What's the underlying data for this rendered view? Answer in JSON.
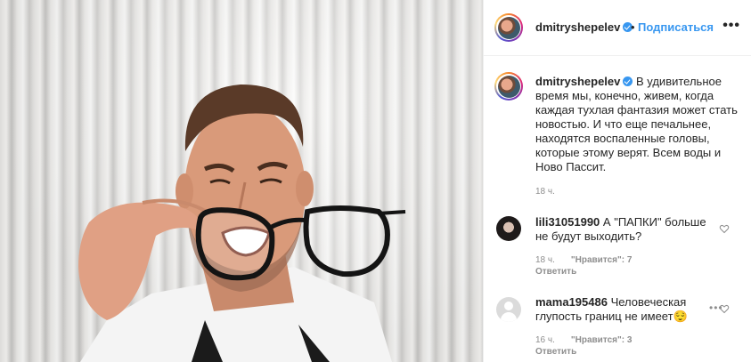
{
  "post": {
    "header": {
      "username": "dmitryshepelev",
      "separator": "•",
      "follow_label": "Подписаться",
      "more_label": "•••"
    },
    "caption": {
      "username": "dmitryshepelev",
      "text": "В удивительное время мы, конечно, живем, когда каждая тухлая фантазия может стать новостью. И что еще печальнее, находятся воспаленные головы, которые этому верят. Всем воды и Ново Пассит.",
      "time": "18 ч."
    },
    "comments": [
      {
        "username": "lili31051990",
        "text": "А \"ПАПКИ\" больше не будут выходить?",
        "time": "18 ч.",
        "likes": "\"Нравится\": 7",
        "reply_label": "Ответить"
      },
      {
        "username": "mama195486",
        "text": "Человеческая глупость границ не имеет😌",
        "time": "16 ч.",
        "likes": "\"Нравится\": 3",
        "reply_label": "Ответить",
        "more_label": "•••"
      }
    ]
  },
  "colors": {
    "accent": "#3897f0",
    "text": "#262626",
    "muted": "#8e8e8e",
    "border": "#efefef"
  },
  "icons": {
    "verified": "verified-badge-icon",
    "more": "more-options-icon",
    "heart": "heart-outline-icon"
  }
}
